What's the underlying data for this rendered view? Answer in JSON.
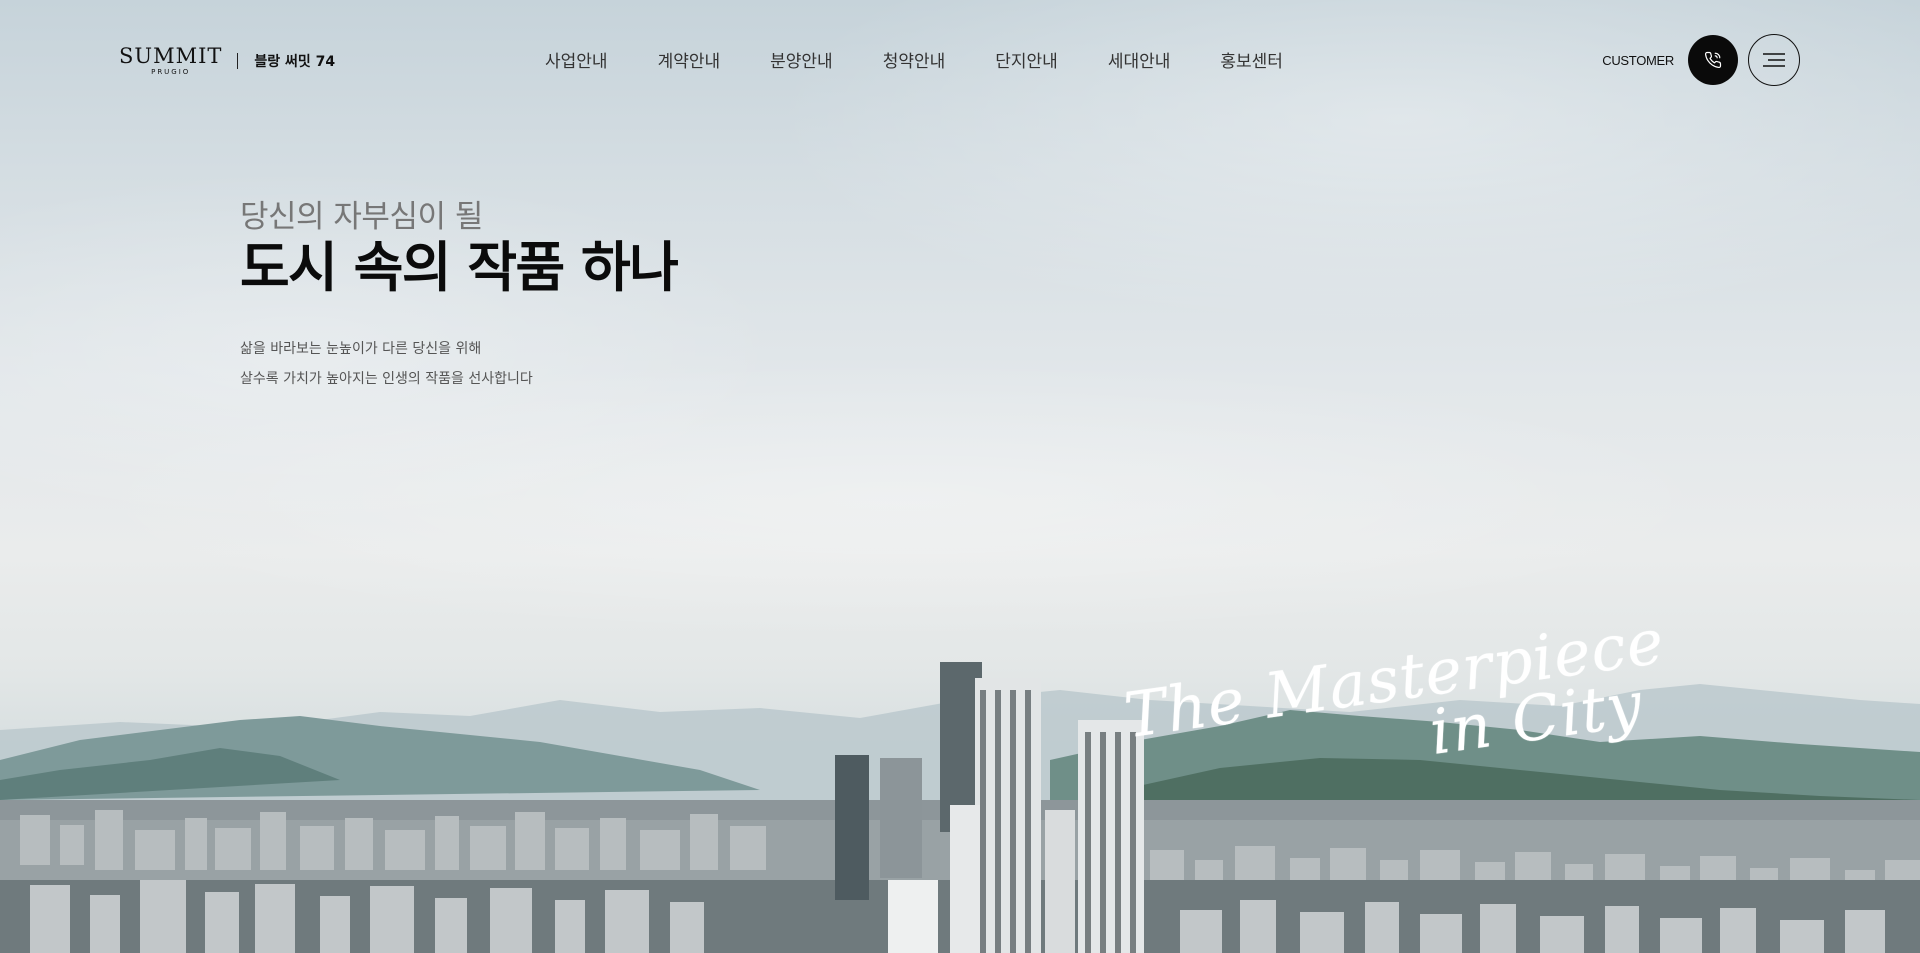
{
  "header": {
    "logo": {
      "brand": "SUMMIT",
      "brand_sub": "PRUGIO",
      "site_name": "블랑 써밋 74"
    },
    "nav": [
      {
        "label": "사업안내"
      },
      {
        "label": "계약안내"
      },
      {
        "label": "분양안내"
      },
      {
        "label": "청약안내"
      },
      {
        "label": "단지안내"
      },
      {
        "label": "세대안내"
      },
      {
        "label": "홍보센터"
      }
    ],
    "customer_label": "CUSTOMER",
    "call_icon": "phone-icon",
    "menu_icon": "hamburger-menu-icon"
  },
  "hero": {
    "kicker": "당신의 자부심이 될",
    "headline": "도시 속의 작품 하나",
    "desc_line1": "삶을 바라보는 눈높이가 다른 당신을 위해",
    "desc_line2": "살수록 가치가 높아지는 인생의 작품을 선사합니다",
    "script_line1": "The Masterpiece",
    "script_line2": "in City"
  },
  "colors": {
    "text_dark": "#0b0b0b",
    "text_muted": "#777777",
    "button_dark": "#0a0a0a",
    "script": "#ffffff"
  }
}
